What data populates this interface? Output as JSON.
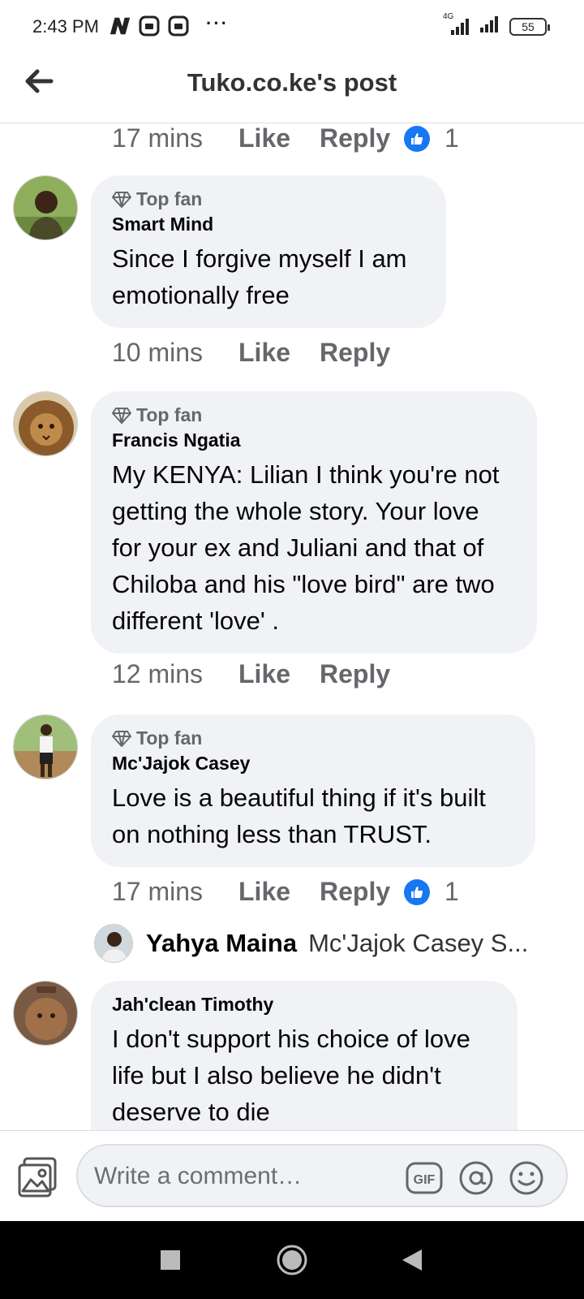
{
  "status_bar": {
    "time": "2:43 PM",
    "more": "···",
    "network": "4G",
    "battery": "55"
  },
  "header": {
    "title": "Tuko.co.ke's post"
  },
  "top_actions": {
    "time": "17 mins",
    "like": "Like",
    "reply": "Reply",
    "reaction_count": "1"
  },
  "comments": [
    {
      "badge": "Top fan",
      "author": "Smart Mind",
      "lines": [
        "Since I forgive myself I am",
        "emotionally free"
      ],
      "time": "10 mins",
      "like": "Like",
      "reply": "Reply"
    },
    {
      "badge": "Top fan",
      "author": "Francis Ngatia",
      "lines": [
        "My KENYA: Lilian I think you're not",
        "getting the whole story. Your love",
        "for your ex and Juliani and that of",
        "Chiloba and his \"love bird\" are two",
        "different 'love' ."
      ],
      "time": "12 mins",
      "like": "Like",
      "reply": "Reply"
    },
    {
      "badge": "Top fan",
      "author": "Mc'Jajok Casey",
      "lines": [
        "Love is a beautiful thing if it's built",
        "on nothing less than TRUST."
      ],
      "time": "17 mins",
      "like": "Like",
      "reply": "Reply",
      "reaction_count": "1",
      "reply_preview": {
        "name": "Yahya Maina",
        "snippet": "Mc'Jajok Casey S..."
      }
    },
    {
      "author": "Jah'clean Timothy",
      "lines": [
        "I don't support his choice of love",
        "life but I also believe he didn't",
        "deserve to die"
      ]
    }
  ],
  "composer": {
    "placeholder": "Write a comment…"
  },
  "colors": {
    "accent": "#1877f2",
    "bubble": "#f0f2f5",
    "secondary_text": "#65676b"
  }
}
